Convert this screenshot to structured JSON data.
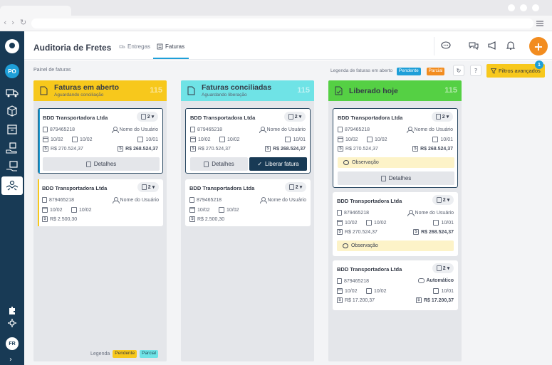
{
  "header": {
    "app_title": "Auditoria de Fretes",
    "tabs": [
      {
        "label": "Entregas",
        "active": false
      },
      {
        "label": "Faturas",
        "active": true
      }
    ],
    "plus_label": "+"
  },
  "sidebar": {
    "avatar_initials": "PO",
    "user_initials": "FR"
  },
  "toolbar": {
    "panel_label": "Painel de faturas",
    "legend_label": "Legenda de faturas em aberto",
    "legend_pending": "Pendente",
    "legend_partial": "Parcial",
    "filter_label": "Filtros avançados",
    "filter_count": "1",
    "help_label": "?"
  },
  "colors": {
    "accent": "#1e9fd8",
    "sidebar": "#183a55",
    "open": "#f7c81c",
    "reconciled": "#6fe3e6",
    "released": "#55d044",
    "orange": "#f28c1f"
  },
  "columns": [
    {
      "title": "Faturas em aberto",
      "subtitle": "Aguardando conciliação",
      "count": "115",
      "cards": [
        {
          "company": "BDD Transportadora Ltda",
          "count": "2",
          "doc": "879465218",
          "user": "Nome do Usuário",
          "date1": "10/02",
          "date2": "10/02",
          "date3": "10/01",
          "value1": "R$ 270.524,37",
          "value2": "R$ 268.524,37",
          "button": "Detalhes"
        },
        {
          "company": "BDD Transportadora Ltda",
          "count": "2",
          "doc": "879465218",
          "user": "Nome do Usuário",
          "date1": "10/02",
          "date2": "10/02",
          "value1": "R$ 2.500,30"
        }
      ],
      "legend_label": "Legenda",
      "legend_pending": "Pendente",
      "legend_partial": "Parcial"
    },
    {
      "title": "Faturas conciliadas",
      "subtitle": "Aguardando liberação",
      "count": "115",
      "cards": [
        {
          "company": "BDD Transportadora Ltda",
          "count": "2",
          "doc": "879465218",
          "user": "Nome do Usuário",
          "date1": "10/02",
          "date2": "10/02",
          "date3": "10/01",
          "value1": "R$ 270.524,37",
          "value2": "R$ 268.524,37",
          "button": "Detalhes",
          "button2": "Liberar fatura"
        },
        {
          "company": "BDD Transportadora Ltda",
          "count": "2",
          "doc": "879465218",
          "user": "Nome do Usuário",
          "date1": "10/02",
          "date2": "10/02",
          "value1": "R$ 2.500,30"
        }
      ]
    },
    {
      "title": "Liberado hoje",
      "subtitle": "",
      "count": "115",
      "cards": [
        {
          "company": "BDD Transportadora Ltda",
          "count": "2",
          "doc": "879465218",
          "user": "Nome do Usuário",
          "date1": "10/02",
          "date2": "10/02",
          "date3": "10/01",
          "value1": "R$ 270.524,37",
          "value2": "R$ 268.524,37",
          "obs": "Observação",
          "button": "Detalhes"
        },
        {
          "company": "BDD Transportadora Ltda",
          "count": "2",
          "doc": "879465218",
          "user": "Nome do Usuário",
          "date1": "10/02",
          "date2": "10/02",
          "date3": "10/01",
          "value1": "R$ 270.524,37",
          "value2": "R$ 268.524,37",
          "obs": "Observação"
        },
        {
          "company": "BDD Transportadora Ltda",
          "count": "2",
          "doc": "879465218",
          "user": "Automático",
          "date1": "10/02",
          "date2": "10/02",
          "date3": "10/01",
          "value1": "R$ 17.200,37",
          "value2": "R$ 17.200,37"
        }
      ]
    }
  ]
}
